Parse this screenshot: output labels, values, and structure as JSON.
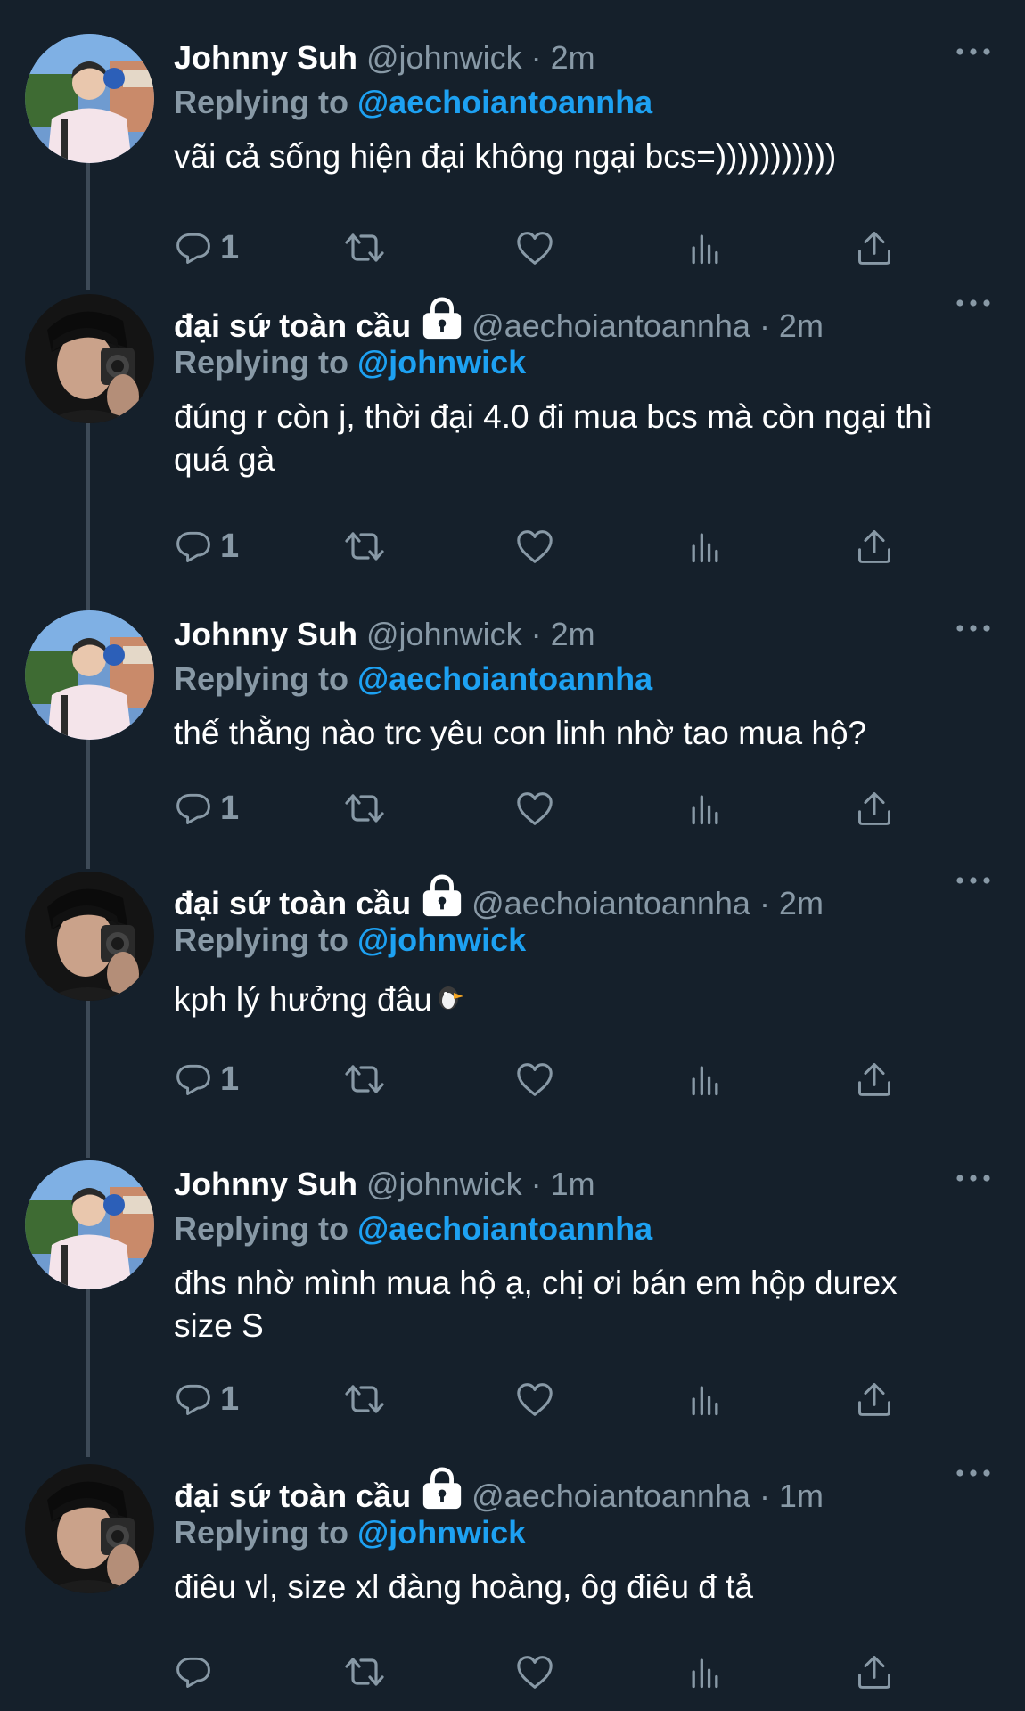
{
  "users": {
    "johnny": {
      "name": "Johnny Suh",
      "handle": "@johnwick"
    },
    "ambassador": {
      "name": "đại sứ toàn cầu",
      "handle": "@aechoiantoannha"
    }
  },
  "reply_label": "Replying to",
  "tweets": [
    {
      "name": "Johnny Suh",
      "handle_time": "@johnwick · 2m",
      "replying_to": "@aechoiantoannha",
      "text": "vãi cả sống hiện đại không ngại bcs=)))))))))))",
      "reply_count": "1"
    },
    {
      "name": "đại sứ toàn cầu",
      "handle_time": "@aechoiantoannha · 2m",
      "replying_to": "@johnwick",
      "text": "đúng r còn j, thời đại 4.0 đi mua bcs mà còn ngại thì quá gà",
      "reply_count": "1"
    },
    {
      "name": "Johnny Suh",
      "handle_time": "@johnwick · 2m",
      "replying_to": "@aechoiantoannha",
      "text": "thế thằng nào trc yêu con linh nhờ tao mua hộ?",
      "reply_count": "1"
    },
    {
      "name": "đại sứ toàn cầu",
      "handle_time": "@aechoiantoannha · 2m",
      "replying_to": "@johnwick",
      "text": "kph lý hưởng đâu",
      "reply_count": "1"
    },
    {
      "name": "Johnny Suh",
      "handle_time": "@johnwick · 1m",
      "replying_to": "@aechoiantoannha",
      "text": "đhs nhờ mình mua hộ ạ, chị ơi bán em hộp durex size S",
      "reply_count": "1"
    },
    {
      "name": "đại sứ toàn cầu",
      "handle_time": "@aechoiantoannha · 1m",
      "replying_to": "@johnwick",
      "text": "điêu vl, size xl đàng hoàng, ôg điêu đ tả",
      "reply_count": ""
    }
  ],
  "icons": {
    "reply": "reply-icon",
    "retweet": "retweet-icon",
    "like": "heart-icon",
    "analytics": "analytics-icon",
    "share": "share-icon",
    "more": "more-icon",
    "lock": "lock-icon"
  },
  "colors": {
    "background": "#15202b",
    "secondary_text": "#8899a6",
    "link": "#1da1f2",
    "thread_line": "#3d4a57"
  }
}
